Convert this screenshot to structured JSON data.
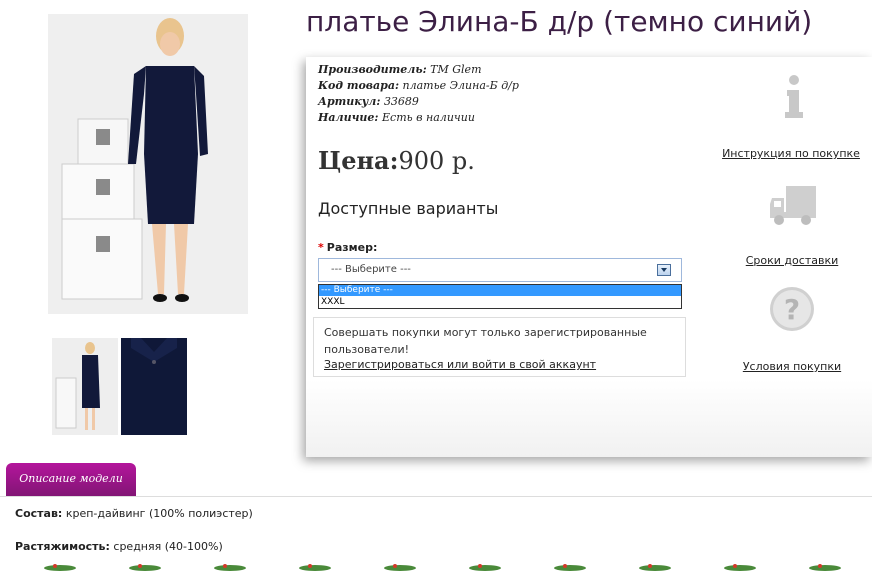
{
  "product": {
    "title": "платье Элина-Б д/р (темно синий)",
    "manufacturer_label": "Производитель:",
    "manufacturer_value": "TM Glem",
    "code_label": "Код товара:",
    "code_value": "платье Элина-Б д/р",
    "article_label": "Артикул:",
    "article_value": "33689",
    "stock_label": "Наличие:",
    "stock_value": "Есть в наличии",
    "price_label": "Цена:",
    "price_value": "900 р."
  },
  "options": {
    "heading": "Доступные варианты",
    "size_required_mark": "*",
    "size_label": "Размер:",
    "selected": "--- Выберите ---",
    "dropdown_items": [
      "--- Выберите ---",
      "XXXL"
    ]
  },
  "notice": {
    "text": "Совершать покупки могут только зарегистрированные пользователи!",
    "link": "Зарегистрироваться или войти в свой аккаунт"
  },
  "sidebar": {
    "instruction": "Инструкция по покупке",
    "delivery": "Сроки доставки",
    "terms": "Условия покупки"
  },
  "description": {
    "tab_label": "Описание модели",
    "composition_label": "Состав:",
    "composition_value": "креп-дайвинг (100% полиэстер)",
    "stretch_label": "Растяжимость:",
    "stretch_value": "средняя (40-100%)"
  },
  "colors": {
    "title": "#3c1f45",
    "tab": "#9b1588",
    "dress": "#12193a",
    "dropdown_highlight": "#3399ff"
  }
}
